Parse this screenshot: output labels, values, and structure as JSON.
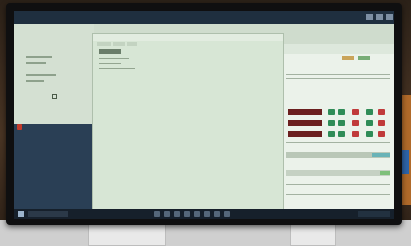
{
  "window": {
    "title": "",
    "app_brand": ""
  },
  "colors": {
    "bezel": "#0f0f10",
    "screen_bg": "#cfdccd",
    "left_dark": "#2a3f55",
    "brand_red": "#c43a2a",
    "row_red": "#6b1f1f",
    "cell_green": "#2f8c57",
    "cell_red": "#c03a3a",
    "accent_teal": "#69b3b7",
    "taskbar": "#16202b"
  },
  "icons": {
    "start": "windows-start-icon",
    "search": "search-icon",
    "tray": "system-tray-icon"
  }
}
